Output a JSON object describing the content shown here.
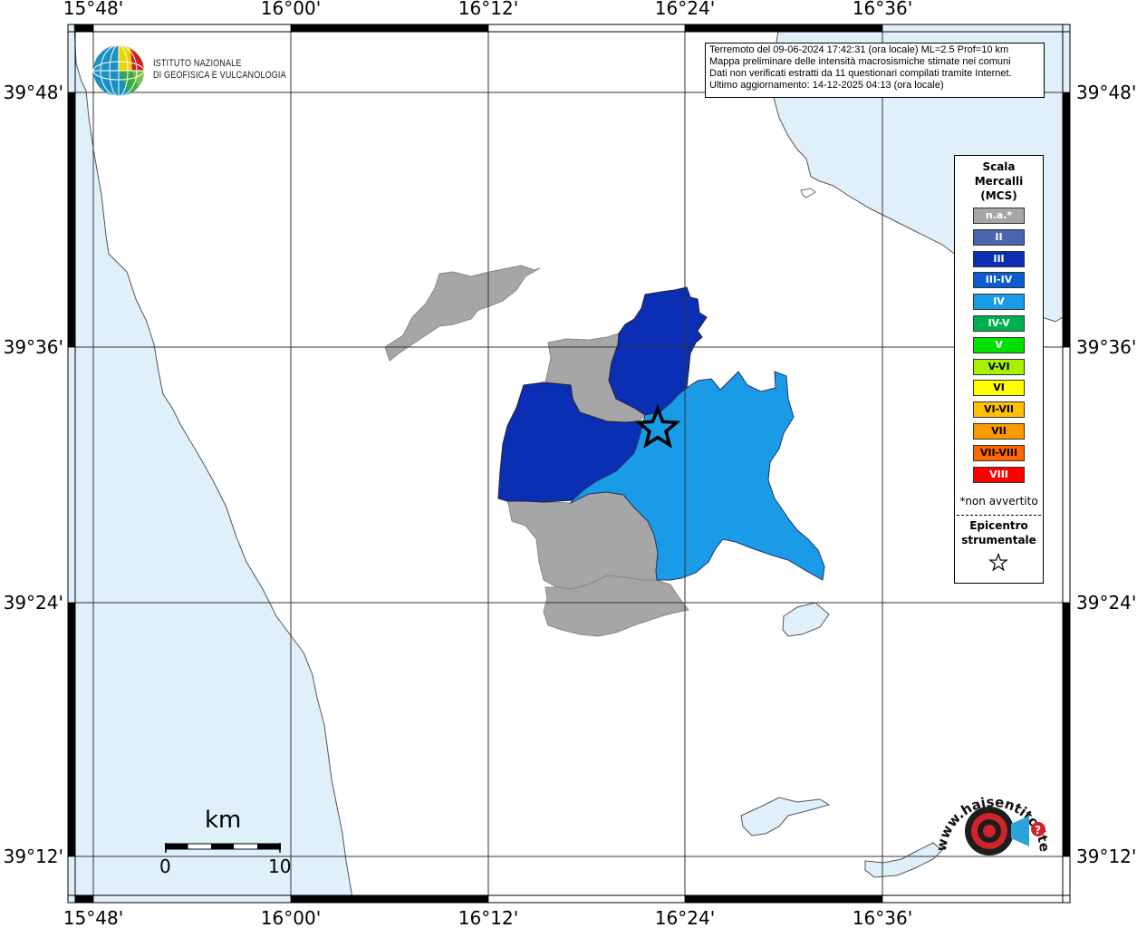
{
  "info_box": {
    "lines": [
      "Terremoto del 09-06-2024 17:42:31 (ora locale) ML=2.5 Prof=10 km",
      "Mappa preliminare delle intensità macrosismiche stimate nei comuni",
      "Dati non verificati estratti da 11 questionari compilati tramite Internet.",
      "Ultimo aggiornamento: 14-12-2025 04:13 (ora locale)"
    ]
  },
  "logo": {
    "line1": "ISTITUTO NAZIONALE",
    "line2": "DI GEOFISICA E VULCANOLOGIA",
    "icon": "ingv-globe-icon"
  },
  "axes": {
    "longitude_ticks": [
      "15°48'",
      "16°00'",
      "16°12'",
      "16°24'",
      "16°36'"
    ],
    "latitude_ticks": [
      "39°48'",
      "39°36'",
      "39°24'",
      "39°12'"
    ]
  },
  "legend": {
    "title_lines": [
      "Scala",
      "Mercalli",
      "(MCS)"
    ],
    "items": [
      {
        "label": "n.a.*",
        "color": "#a6a6a6"
      },
      {
        "label": "II",
        "color": "#4a64b0"
      },
      {
        "label": "III",
        "color": "#0a2fb4"
      },
      {
        "label": "III-IV",
        "color": "#0a5cd0"
      },
      {
        "label": "IV",
        "color": "#1a9be8"
      },
      {
        "label": "IV-V",
        "color": "#00b050"
      },
      {
        "label": "V",
        "color": "#00e000"
      },
      {
        "label": "V-VI",
        "color": "#a8f000"
      },
      {
        "label": "VI",
        "color": "#ffff00"
      },
      {
        "label": "VI-VII",
        "color": "#ffc000"
      },
      {
        "label": "VII",
        "color": "#ff9900"
      },
      {
        "label": "VII-VIII",
        "color": "#ff6600"
      },
      {
        "label": "VIII",
        "color": "#ff0000"
      }
    ],
    "note": "*non avvertito",
    "epicenter_lines": [
      "Epicentro",
      "strumentale"
    ]
  },
  "scale_bar": {
    "unit": "km",
    "start": "0",
    "end": "10"
  },
  "colors": {
    "sea": "#dff0fb",
    "not_available": "#a6a6a6",
    "intensity_III": "#0a2fb4",
    "intensity_IV": "#1a9be8"
  },
  "watermark": {
    "text": "www.haisentitoilterremoto.it",
    "icon": "hai-sentito-il-terremoto-logo-icon"
  }
}
